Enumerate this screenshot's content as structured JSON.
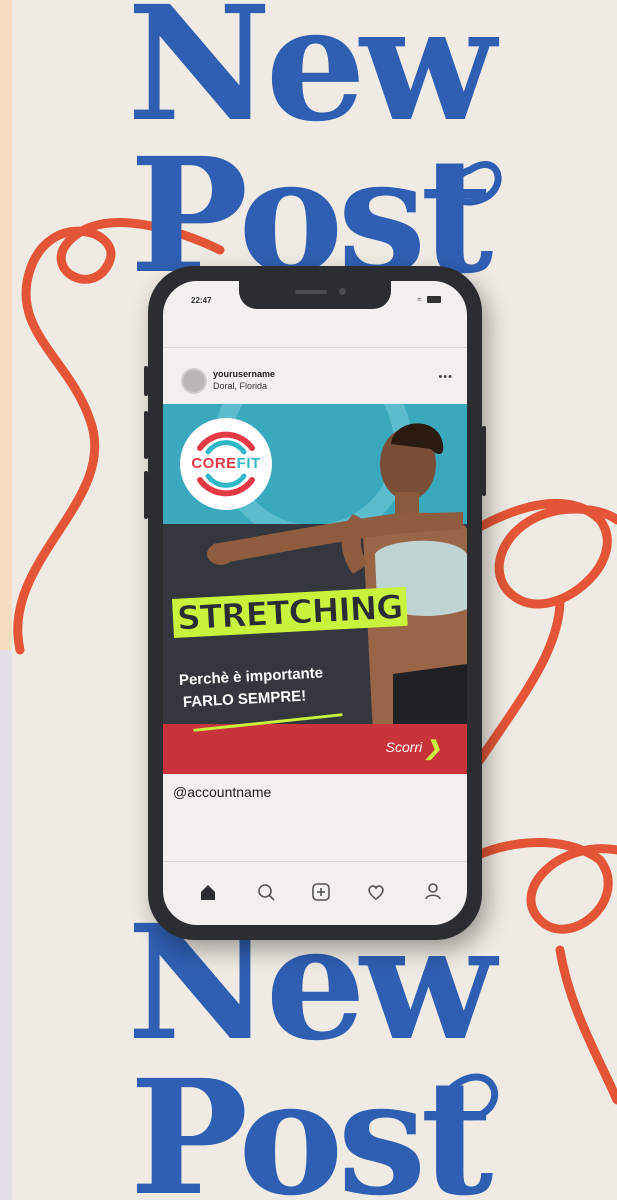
{
  "poster": {
    "headline_top_line1": "New",
    "headline_top_line2": "Post",
    "headline_bottom_line1": "New",
    "headline_bottom_line2": "Post",
    "headline_color": "#2f5fb3",
    "ribbon_color": "#e35536",
    "background_color": "#efebe4"
  },
  "phone": {
    "status_time": "22:47",
    "post": {
      "username": "yourusername",
      "location": "Doral, Florida",
      "more_icon": "ellipsis-icon",
      "image": {
        "logo_core": "CORE",
        "logo_fit": "FIT",
        "title": "STRETCHING",
        "subtitle_line1": "Perchè è importante",
        "subtitle_line2": "FARLO SEMPRE!",
        "swipe_label": "Scorri"
      },
      "caption": "@accountname"
    },
    "nav": [
      "home-icon",
      "search-icon",
      "add-post-icon",
      "heart-icon",
      "profile-icon"
    ]
  }
}
